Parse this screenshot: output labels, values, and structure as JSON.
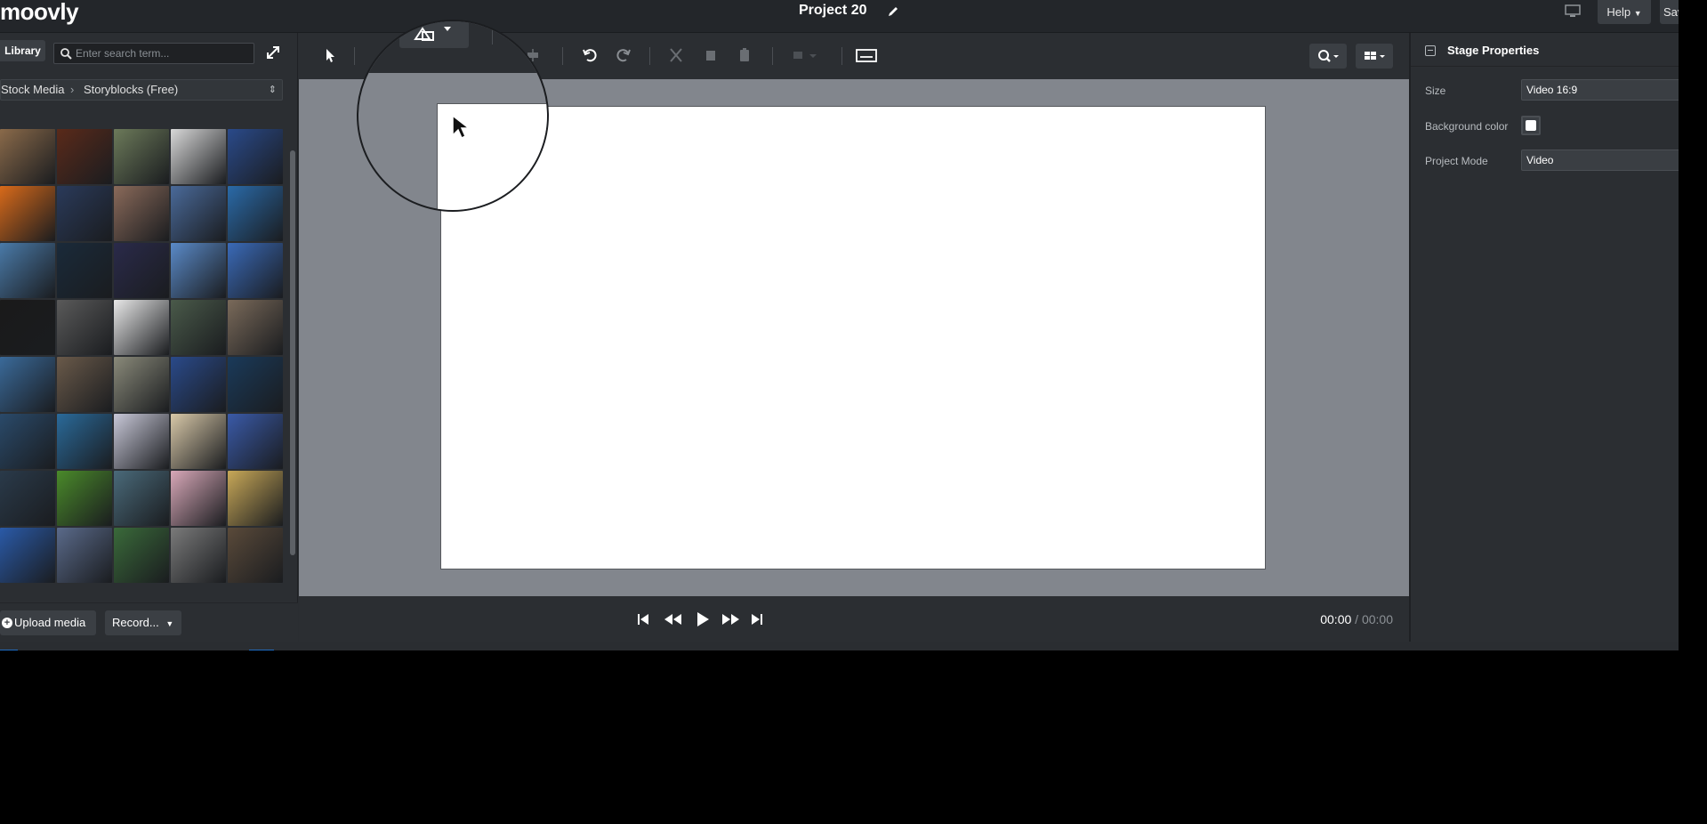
{
  "app": {
    "logo": "moovly",
    "project_title": "Project 20"
  },
  "topbar": {
    "help_label": "Help",
    "save_label": "Save"
  },
  "library": {
    "tab_label": "Library",
    "search_placeholder": "Enter search term...",
    "source": "Stock Media",
    "collection": "Storyblocks (Free)",
    "upload_label": "Upload media",
    "record_label": "Record..."
  },
  "thumbnails": [
    "#8a6a4a",
    "#5a2a1a",
    "#6c7a5a",
    "#d8d8d8",
    "#2a4a8a",
    "#d86a1a",
    "#2a3a5a",
    "#8a6a5a",
    "#4a6a9a",
    "#2a6aa8",
    "#4a7aa8",
    "#1a2a3a",
    "#2a2a4a",
    "#5a8ac8",
    "#3a6ab8",
    "#1a1a1a",
    "#5a5a5a",
    "#e8e8e8",
    "#4a5a4a",
    "#7a6a5a",
    "#3a6a9a",
    "#6a5a4a",
    "#8a8a7a",
    "#2a4a8a",
    "#1a3a5a",
    "#2a4a6a",
    "#2a6a9a",
    "#c8c8d8",
    "#d8c8a8",
    "#3a5aa8",
    "#2a3a4a",
    "#4a8a2a",
    "#4a6a7a",
    "#d8a8b8",
    "#c8a858",
    "#2a5aa8",
    "#5a6a8a",
    "#3a6a3a",
    "#7a7a7a",
    "#5a4a3a"
  ],
  "properties": {
    "title": "Stage Properties",
    "size_label": "Size",
    "size_value": "Video 16:9",
    "bg_label": "Background color",
    "bg_color": "#ffffff",
    "mode_label": "Project Mode",
    "mode_value": "Video"
  },
  "playback": {
    "current": "00:00",
    "separator": "/",
    "duration": "00:00"
  },
  "colors": {
    "accent": "#1f6cc4",
    "stage_bg": "#82868d",
    "panel_bg": "#2b2e32"
  }
}
